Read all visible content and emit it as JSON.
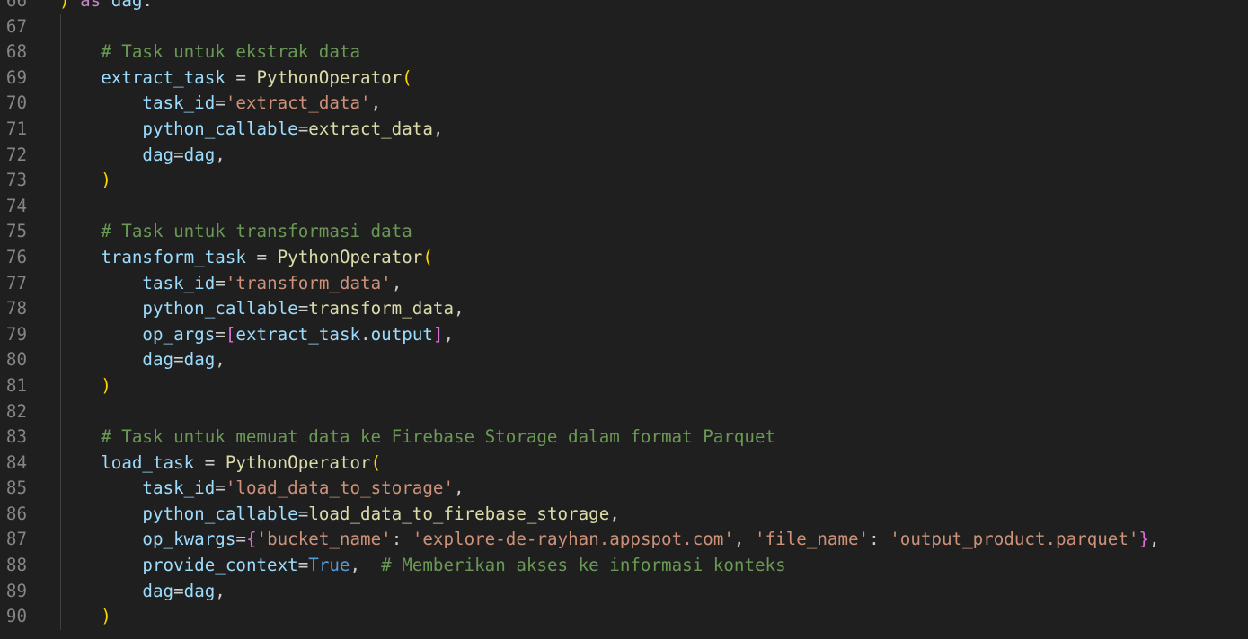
{
  "editor": {
    "lines": [
      {
        "number": "66",
        "indent": 0,
        "tokens": [
          {
            "t": ")",
            "c": "b1"
          },
          {
            "t": " ",
            "c": "plain"
          },
          {
            "t": "as",
            "c": "kw"
          },
          {
            "t": " ",
            "c": "plain"
          },
          {
            "t": "dag",
            "c": "var"
          },
          {
            "t": ":",
            "c": "plain"
          }
        ]
      },
      {
        "number": "67",
        "indent": 1,
        "tokens": []
      },
      {
        "number": "68",
        "indent": 1,
        "tokens": [
          {
            "t": "    # Task untuk ekstrak data",
            "c": "com"
          }
        ]
      },
      {
        "number": "69",
        "indent": 1,
        "tokens": [
          {
            "t": "    ",
            "c": "plain"
          },
          {
            "t": "extract_task",
            "c": "var"
          },
          {
            "t": " = ",
            "c": "plain"
          },
          {
            "t": "PythonOperator",
            "c": "fn"
          },
          {
            "t": "(",
            "c": "b1"
          }
        ]
      },
      {
        "number": "70",
        "indent": 2,
        "tokens": [
          {
            "t": "        ",
            "c": "plain"
          },
          {
            "t": "task_id",
            "c": "var"
          },
          {
            "t": "=",
            "c": "plain"
          },
          {
            "t": "'extract_data'",
            "c": "str"
          },
          {
            "t": ",",
            "c": "plain"
          }
        ]
      },
      {
        "number": "71",
        "indent": 2,
        "tokens": [
          {
            "t": "        ",
            "c": "plain"
          },
          {
            "t": "python_callable",
            "c": "var"
          },
          {
            "t": "=",
            "c": "plain"
          },
          {
            "t": "extract_data",
            "c": "fn"
          },
          {
            "t": ",",
            "c": "plain"
          }
        ]
      },
      {
        "number": "72",
        "indent": 2,
        "tokens": [
          {
            "t": "        ",
            "c": "plain"
          },
          {
            "t": "dag",
            "c": "var"
          },
          {
            "t": "=",
            "c": "plain"
          },
          {
            "t": "dag",
            "c": "var"
          },
          {
            "t": ",",
            "c": "plain"
          }
        ]
      },
      {
        "number": "73",
        "indent": 1,
        "tokens": [
          {
            "t": "    ",
            "c": "plain"
          },
          {
            "t": ")",
            "c": "b1"
          }
        ]
      },
      {
        "number": "74",
        "indent": 1,
        "tokens": []
      },
      {
        "number": "75",
        "indent": 1,
        "tokens": [
          {
            "t": "    # Task untuk transformasi data",
            "c": "com"
          }
        ]
      },
      {
        "number": "76",
        "indent": 1,
        "tokens": [
          {
            "t": "    ",
            "c": "plain"
          },
          {
            "t": "transform_task",
            "c": "var"
          },
          {
            "t": " = ",
            "c": "plain"
          },
          {
            "t": "PythonOperator",
            "c": "fn"
          },
          {
            "t": "(",
            "c": "b1"
          }
        ]
      },
      {
        "number": "77",
        "indent": 2,
        "tokens": [
          {
            "t": "        ",
            "c": "plain"
          },
          {
            "t": "task_id",
            "c": "var"
          },
          {
            "t": "=",
            "c": "plain"
          },
          {
            "t": "'transform_data'",
            "c": "str"
          },
          {
            "t": ",",
            "c": "plain"
          }
        ]
      },
      {
        "number": "78",
        "indent": 2,
        "tokens": [
          {
            "t": "        ",
            "c": "plain"
          },
          {
            "t": "python_callable",
            "c": "var"
          },
          {
            "t": "=",
            "c": "plain"
          },
          {
            "t": "transform_data",
            "c": "fn"
          },
          {
            "t": ",",
            "c": "plain"
          }
        ]
      },
      {
        "number": "79",
        "indent": 2,
        "tokens": [
          {
            "t": "        ",
            "c": "plain"
          },
          {
            "t": "op_args",
            "c": "var"
          },
          {
            "t": "=",
            "c": "plain"
          },
          {
            "t": "[",
            "c": "b2"
          },
          {
            "t": "extract_task",
            "c": "var"
          },
          {
            "t": ".",
            "c": "plain"
          },
          {
            "t": "output",
            "c": "var"
          },
          {
            "t": "]",
            "c": "b2"
          },
          {
            "t": ",",
            "c": "plain"
          }
        ]
      },
      {
        "number": "80",
        "indent": 2,
        "tokens": [
          {
            "t": "        ",
            "c": "plain"
          },
          {
            "t": "dag",
            "c": "var"
          },
          {
            "t": "=",
            "c": "plain"
          },
          {
            "t": "dag",
            "c": "var"
          },
          {
            "t": ",",
            "c": "plain"
          }
        ]
      },
      {
        "number": "81",
        "indent": 1,
        "tokens": [
          {
            "t": "    ",
            "c": "plain"
          },
          {
            "t": ")",
            "c": "b1"
          }
        ]
      },
      {
        "number": "82",
        "indent": 1,
        "tokens": []
      },
      {
        "number": "83",
        "indent": 1,
        "tokens": [
          {
            "t": "    # Task untuk memuat data ke Firebase Storage dalam format Parquet",
            "c": "com"
          }
        ]
      },
      {
        "number": "84",
        "indent": 1,
        "tokens": [
          {
            "t": "    ",
            "c": "plain"
          },
          {
            "t": "load_task",
            "c": "var"
          },
          {
            "t": " = ",
            "c": "plain"
          },
          {
            "t": "PythonOperator",
            "c": "fn"
          },
          {
            "t": "(",
            "c": "b1"
          }
        ]
      },
      {
        "number": "85",
        "indent": 2,
        "tokens": [
          {
            "t": "        ",
            "c": "plain"
          },
          {
            "t": "task_id",
            "c": "var"
          },
          {
            "t": "=",
            "c": "plain"
          },
          {
            "t": "'load_data_to_storage'",
            "c": "str"
          },
          {
            "t": ",",
            "c": "plain"
          }
        ]
      },
      {
        "number": "86",
        "indent": 2,
        "tokens": [
          {
            "t": "        ",
            "c": "plain"
          },
          {
            "t": "python_callable",
            "c": "var"
          },
          {
            "t": "=",
            "c": "plain"
          },
          {
            "t": "load_data_to_firebase_storage",
            "c": "fn"
          },
          {
            "t": ",",
            "c": "plain"
          }
        ]
      },
      {
        "number": "87",
        "indent": 2,
        "tokens": [
          {
            "t": "        ",
            "c": "plain"
          },
          {
            "t": "op_kwargs",
            "c": "var"
          },
          {
            "t": "=",
            "c": "plain"
          },
          {
            "t": "{",
            "c": "b2"
          },
          {
            "t": "'bucket_name'",
            "c": "str"
          },
          {
            "t": ": ",
            "c": "plain"
          },
          {
            "t": "'explore-de-rayhan.appspot.com'",
            "c": "str"
          },
          {
            "t": ", ",
            "c": "plain"
          },
          {
            "t": "'file_name'",
            "c": "str"
          },
          {
            "t": ": ",
            "c": "plain"
          },
          {
            "t": "'output_product.parquet'",
            "c": "str"
          },
          {
            "t": "}",
            "c": "b2"
          },
          {
            "t": ",",
            "c": "plain"
          }
        ]
      },
      {
        "number": "88",
        "indent": 2,
        "tokens": [
          {
            "t": "        ",
            "c": "plain"
          },
          {
            "t": "provide_context",
            "c": "var"
          },
          {
            "t": "=",
            "c": "plain"
          },
          {
            "t": "True",
            "c": "const"
          },
          {
            "t": ",  ",
            "c": "plain"
          },
          {
            "t": "# Memberikan akses ke informasi konteks",
            "c": "com"
          }
        ]
      },
      {
        "number": "89",
        "indent": 2,
        "tokens": [
          {
            "t": "        ",
            "c": "plain"
          },
          {
            "t": "dag",
            "c": "var"
          },
          {
            "t": "=",
            "c": "plain"
          },
          {
            "t": "dag",
            "c": "var"
          },
          {
            "t": ",",
            "c": "plain"
          }
        ]
      },
      {
        "number": "90",
        "indent": 1,
        "tokens": [
          {
            "t": "    ",
            "c": "plain"
          },
          {
            "t": ")",
            "c": "b1"
          }
        ]
      }
    ]
  },
  "theme": {
    "background": "#1f1f1f",
    "line_number": "#858585",
    "keyword": "#c586c0",
    "variable": "#9cdcfe",
    "function": "#dcdcaa",
    "string": "#ce9178",
    "comment": "#6a9955",
    "constant": "#569cd6",
    "bracket_level1": "#ffd700",
    "bracket_level2": "#da70d6"
  }
}
